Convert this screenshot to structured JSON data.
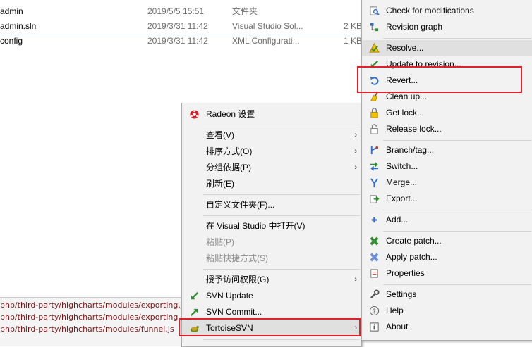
{
  "files": [
    {
      "name": "admin",
      "date": "2019/5/5 15:51",
      "type": "文件夹",
      "size": ""
    },
    {
      "name": "admin.sln",
      "date": "2019/3/31 11:42",
      "type": "Visual Studio Sol...",
      "size": "2 KB"
    },
    {
      "name": "config",
      "date": "2019/3/31 11:42",
      "type": "XML Configurati...",
      "size": "1 KB"
    }
  ],
  "log_lines": [
    "php/third-party/highcharts/modules/exporting.js",
    "php/third-party/highcharts/modules/exporting.src.js",
    "php/third-party/highcharts/modules/funnel.js"
  ],
  "context_menu": {
    "items": [
      {
        "label": "Radeon 设置",
        "icon": "radeon-icon"
      },
      {
        "label": "查看(V)",
        "submenu": true
      },
      {
        "label": "排序方式(O)",
        "submenu": true
      },
      {
        "label": "分组依据(P)",
        "submenu": true
      },
      {
        "label": "刷新(E)"
      },
      {
        "label": "自定义文件夹(F)..."
      },
      {
        "label": "在 Visual Studio 中打开(V)"
      },
      {
        "label": "粘贴(P)",
        "disabled": true
      },
      {
        "label": "粘贴快捷方式(S)",
        "disabled": true
      },
      {
        "label": "授予访问权限(G)",
        "submenu": true
      },
      {
        "label": "SVN Update",
        "icon": "svn-update-icon"
      },
      {
        "label": "SVN Commit...",
        "icon": "svn-commit-icon"
      },
      {
        "label": "TortoiseSVN",
        "icon": "tortoisesvn-icon",
        "submenu": true
      }
    ],
    "arrow_glyph": "›"
  },
  "svn_menu": {
    "items": [
      {
        "label": "Check for modifications",
        "icon": "check-modifications-icon"
      },
      {
        "label": "Revision graph",
        "icon": "revision-graph-icon"
      },
      {
        "label": "Resolve...",
        "icon": "resolve-icon"
      },
      {
        "label": "Update to revision...",
        "icon": "update-revision-icon"
      },
      {
        "label": "Revert...",
        "icon": "revert-icon"
      },
      {
        "label": "Clean up...",
        "icon": "cleanup-icon"
      },
      {
        "label": "Get lock...",
        "icon": "get-lock-icon"
      },
      {
        "label": "Release lock...",
        "icon": "release-lock-icon"
      },
      {
        "label": "Branch/tag...",
        "icon": "branch-tag-icon"
      },
      {
        "label": "Switch...",
        "icon": "switch-icon"
      },
      {
        "label": "Merge...",
        "icon": "merge-icon"
      },
      {
        "label": "Export...",
        "icon": "export-icon"
      },
      {
        "label": "Add...",
        "icon": "add-icon"
      },
      {
        "label": "Create patch...",
        "icon": "create-patch-icon"
      },
      {
        "label": "Apply patch...",
        "icon": "apply-patch-icon"
      },
      {
        "label": "Properties",
        "icon": "properties-icon"
      },
      {
        "label": "Settings",
        "icon": "settings-icon"
      },
      {
        "label": "Help",
        "icon": "help-icon"
      },
      {
        "label": "About",
        "icon": "about-icon"
      }
    ]
  },
  "colors": {
    "highlight_border": "#e0202a",
    "menu_bg": "#f2f2f2"
  }
}
